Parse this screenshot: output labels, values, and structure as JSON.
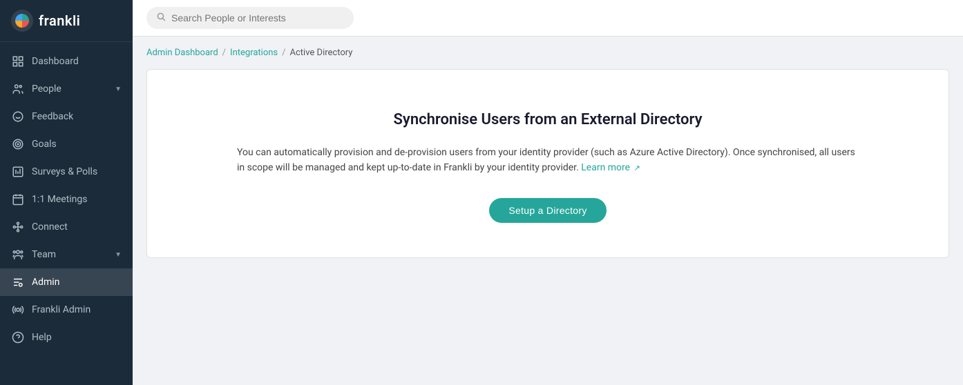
{
  "logo": {
    "text": "frankli"
  },
  "sidebar": {
    "items": [
      {
        "id": "dashboard",
        "label": "Dashboard",
        "icon": "dashboard",
        "active": false
      },
      {
        "id": "people",
        "label": "People",
        "icon": "people",
        "hasChevron": true,
        "active": false
      },
      {
        "id": "feedback",
        "label": "Feedback",
        "icon": "feedback",
        "active": false
      },
      {
        "id": "goals",
        "label": "Goals",
        "icon": "goals",
        "active": false
      },
      {
        "id": "surveys",
        "label": "Surveys & Polls",
        "icon": "surveys",
        "active": false
      },
      {
        "id": "meetings",
        "label": "1:1 Meetings",
        "icon": "meetings",
        "active": false
      },
      {
        "id": "connect",
        "label": "Connect",
        "icon": "connect",
        "active": false
      },
      {
        "id": "team",
        "label": "Team",
        "icon": "team",
        "hasChevron": true,
        "active": false
      },
      {
        "id": "admin",
        "label": "Admin",
        "icon": "admin",
        "active": true
      },
      {
        "id": "frankli-admin",
        "label": "Frankli Admin",
        "icon": "frankli-admin",
        "active": false
      },
      {
        "id": "help",
        "label": "Help",
        "icon": "help",
        "active": false
      }
    ]
  },
  "search": {
    "placeholder": "Search People or Interests"
  },
  "breadcrumb": {
    "items": [
      {
        "label": "Admin Dashboard",
        "link": true
      },
      {
        "label": "Integrations",
        "link": true
      },
      {
        "label": "Active Directory",
        "link": false
      }
    ]
  },
  "card": {
    "title": "Synchronise Users from an External Directory",
    "description": "You can automatically provision and de-provision users from your identity provider (such as Azure Active Directory). Once synchronised, all users in scope will be managed and kept up-to-date in Frankli by your identity provider.",
    "learn_more": "Learn more",
    "setup_button": "Setup a Directory"
  }
}
